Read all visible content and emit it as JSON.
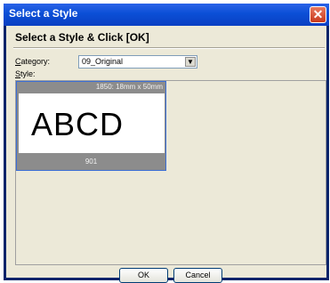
{
  "window": {
    "title": "Select a Style",
    "close_glyph": "✕"
  },
  "header": {
    "text": "Select a Style & Click [OK]"
  },
  "category": {
    "label_u": "C",
    "label_rest": "ategory:",
    "value": "09_Original",
    "arrow_glyph": "▼"
  },
  "style": {
    "label_u": "S",
    "label_rest": "tyle:",
    "thumbnail": {
      "size_text": "1850: 18mm x 50mm",
      "preview_text": "ABCD",
      "number": "901"
    }
  },
  "buttons": {
    "ok": "OK",
    "cancel": "Cancel"
  }
}
